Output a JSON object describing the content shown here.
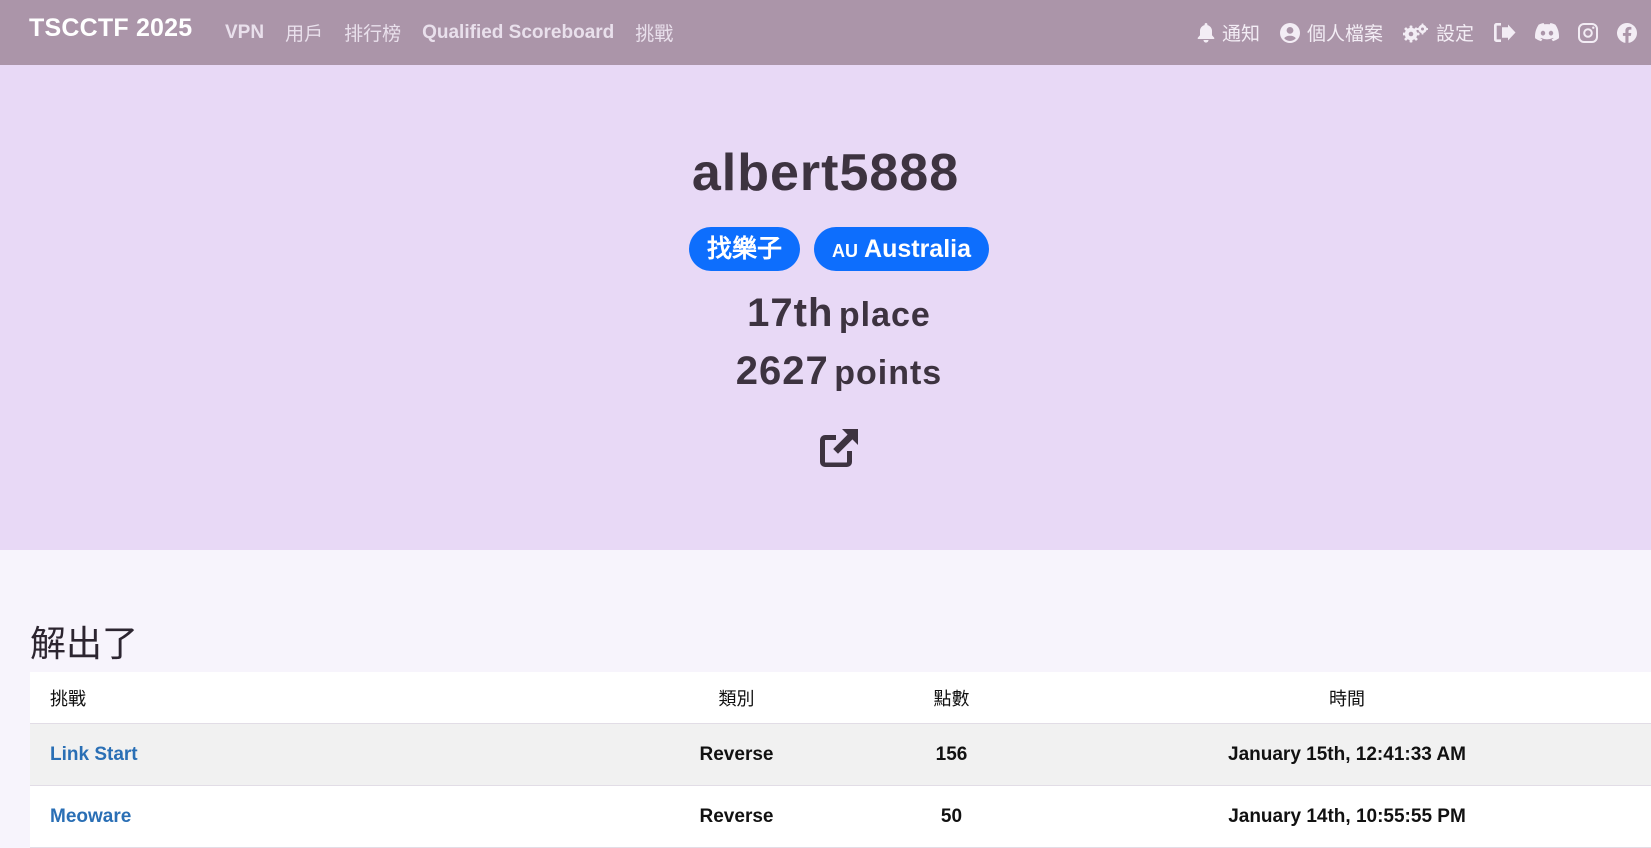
{
  "navbar": {
    "brand": "TSCCTF 2025",
    "left_links": [
      {
        "label": "VPN",
        "bold": true
      },
      {
        "label": "用戶",
        "bold": false
      },
      {
        "label": "排行榜",
        "bold": false
      },
      {
        "label": "Qualified Scoreboard",
        "bold": true
      },
      {
        "label": "挑戰",
        "bold": false
      }
    ],
    "notifications_label": "通知",
    "profile_label": "個人檔案",
    "settings_label": "設定",
    "icons": [
      "bell-icon",
      "user-circle-icon",
      "gears-icon",
      "logout-icon",
      "discord-icon",
      "instagram-icon",
      "facebook-icon"
    ]
  },
  "profile": {
    "username": "albert5888",
    "team_badge": "找樂子",
    "country_code": "AU",
    "country_name": "Australia",
    "place_value": "17th",
    "place_unit": "place",
    "points_value": "2627",
    "points_unit": "points",
    "badge_color": "#0d6efd"
  },
  "solves": {
    "title": "解出了",
    "headers": {
      "challenge": "挑戰",
      "category": "類別",
      "points": "點數",
      "time": "時間"
    },
    "rows": [
      {
        "challenge": "Link Start",
        "category": "Reverse",
        "points": "156",
        "time": "January 15th, 12:41:33 AM"
      },
      {
        "challenge": "Meoware",
        "category": "Reverse",
        "points": "50",
        "time": "January 14th, 10:55:55 PM"
      }
    ]
  },
  "colors": {
    "navbar_bg": "#ab95a9",
    "jumbotron_bg": "#e8d9f6",
    "link_color": "#2a6fb5"
  }
}
